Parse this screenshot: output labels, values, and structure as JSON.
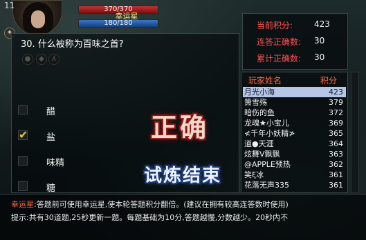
{
  "hud": {
    "level": "11",
    "hp_text": "370/370",
    "mp_text": "180/180",
    "name": "幸运星",
    "hp_fraction": 1.0,
    "mp_fraction": 1.0
  },
  "quiz": {
    "question": "30. 什么被称为百味之首?",
    "options": [
      {
        "label": "醋",
        "checked": false
      },
      {
        "label": "盐",
        "checked": true
      },
      {
        "label": "味精",
        "checked": false
      },
      {
        "label": "糖",
        "checked": false
      }
    ],
    "result_label": "正确",
    "end_button_label": "试炼结束"
  },
  "stats": {
    "score_label": "当前积分:",
    "score_value": "423",
    "streak_label": "连答正确数:",
    "streak_value": "30",
    "total_label": "累计正确数:",
    "total_value": "30"
  },
  "ranking": {
    "col_name": "玩家姓名",
    "col_score": "积分",
    "rows": [
      {
        "name": "月光小海",
        "score": "423"
      },
      {
        "name": "箫雪殇",
        "score": "379"
      },
      {
        "name": "暗伤的鱼",
        "score": "372"
      },
      {
        "name": "龙魂★小宝儿",
        "score": "369"
      },
      {
        "name": "≮千年小妖精≯",
        "score": "365"
      },
      {
        "name": "道●天涯",
        "score": "364"
      },
      {
        "name": "炫舞V飘飘",
        "score": "363"
      },
      {
        "name": "@APPLE预热",
        "score": "362"
      },
      {
        "name": "笑ξ冰",
        "score": "361"
      },
      {
        "name": "花落无声335",
        "score": "361"
      }
    ]
  },
  "info": {
    "hint1_name": "幸运星",
    "hint1_text": ":答题前可使用幸运星,使本轮答题积分翻倍。(建议在拥有较高连答数时使用)",
    "hint2": "提示:共有30道题,25秒更新一题。每题基础为10分,答题越慢,分数越少。20秒内不"
  },
  "colors": {
    "accent_red": "#ff5050",
    "header_orange": "#ff6a3c",
    "check_yellow": "#e3c62a",
    "selected_row": "#b7c6e6"
  }
}
